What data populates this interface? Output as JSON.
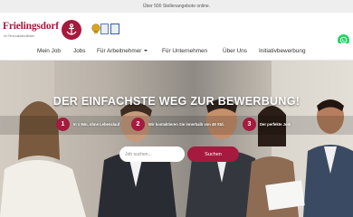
{
  "topbar": {
    "text": "Über 500 Stellenangebote online."
  },
  "header": {
    "logo_name": "Frielingsdorf",
    "logo_tagline": "Ihr Personaldienstleister",
    "brand_color": "#a51a3e"
  },
  "nav": {
    "items": [
      {
        "label": "Mein Job"
      },
      {
        "label": "Jobs"
      },
      {
        "label": "Für Arbeitnehmer",
        "has_dropdown": true
      },
      {
        "label": "Für Unternehmen"
      },
      {
        "label": "Über Uns"
      },
      {
        "label": "Initiativbewerbung"
      }
    ]
  },
  "hero": {
    "title": "DER EINFACHSTE WEG ZUR BEWERBUNG!",
    "steps": [
      {
        "number": "1",
        "text": "In 1 Min. ohne Lebenslauf"
      },
      {
        "number": "2",
        "text": "Wir kontaktieren Sie innerhalb von 48 Std."
      },
      {
        "number": "3",
        "text": "Der perfekte Job!"
      }
    ],
    "search": {
      "placeholder": "Job suchen...",
      "button_label": "Suchen"
    }
  },
  "icons": {
    "logo_mark": "anchor-icon",
    "whatsapp": "whatsapp-icon"
  }
}
